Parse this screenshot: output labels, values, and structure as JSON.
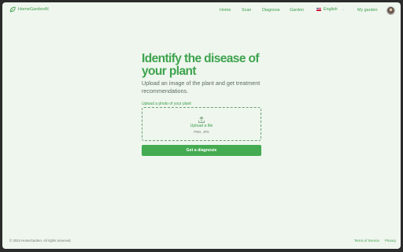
{
  "header": {
    "brand": "HomeGardenAI",
    "nav": [
      "Home",
      "Scan",
      "Diagnose",
      "Garden"
    ],
    "language": "English",
    "my_garden": "My garden"
  },
  "main": {
    "title": "Identify the disease of your plant",
    "subtitle": "Upload an image of the plant and get treatment recommendations.",
    "upload_label": "Upload a photo of your plant",
    "dropzone_text": "Upload a file",
    "dropzone_hint": "PNG, JPG",
    "button": "Get a diagnosis"
  },
  "footer": {
    "copyright": "© 2024 HomeGarden. All rights reserved.",
    "terms": "Terms of Service",
    "privacy": "Privacy"
  },
  "colors": {
    "accent": "#45ab52",
    "background": "#eef6ee",
    "text_muted": "#5f6b62"
  },
  "icons": [
    "leaf-icon",
    "flag-icon",
    "chevron-down-icon",
    "upload-icon"
  ]
}
